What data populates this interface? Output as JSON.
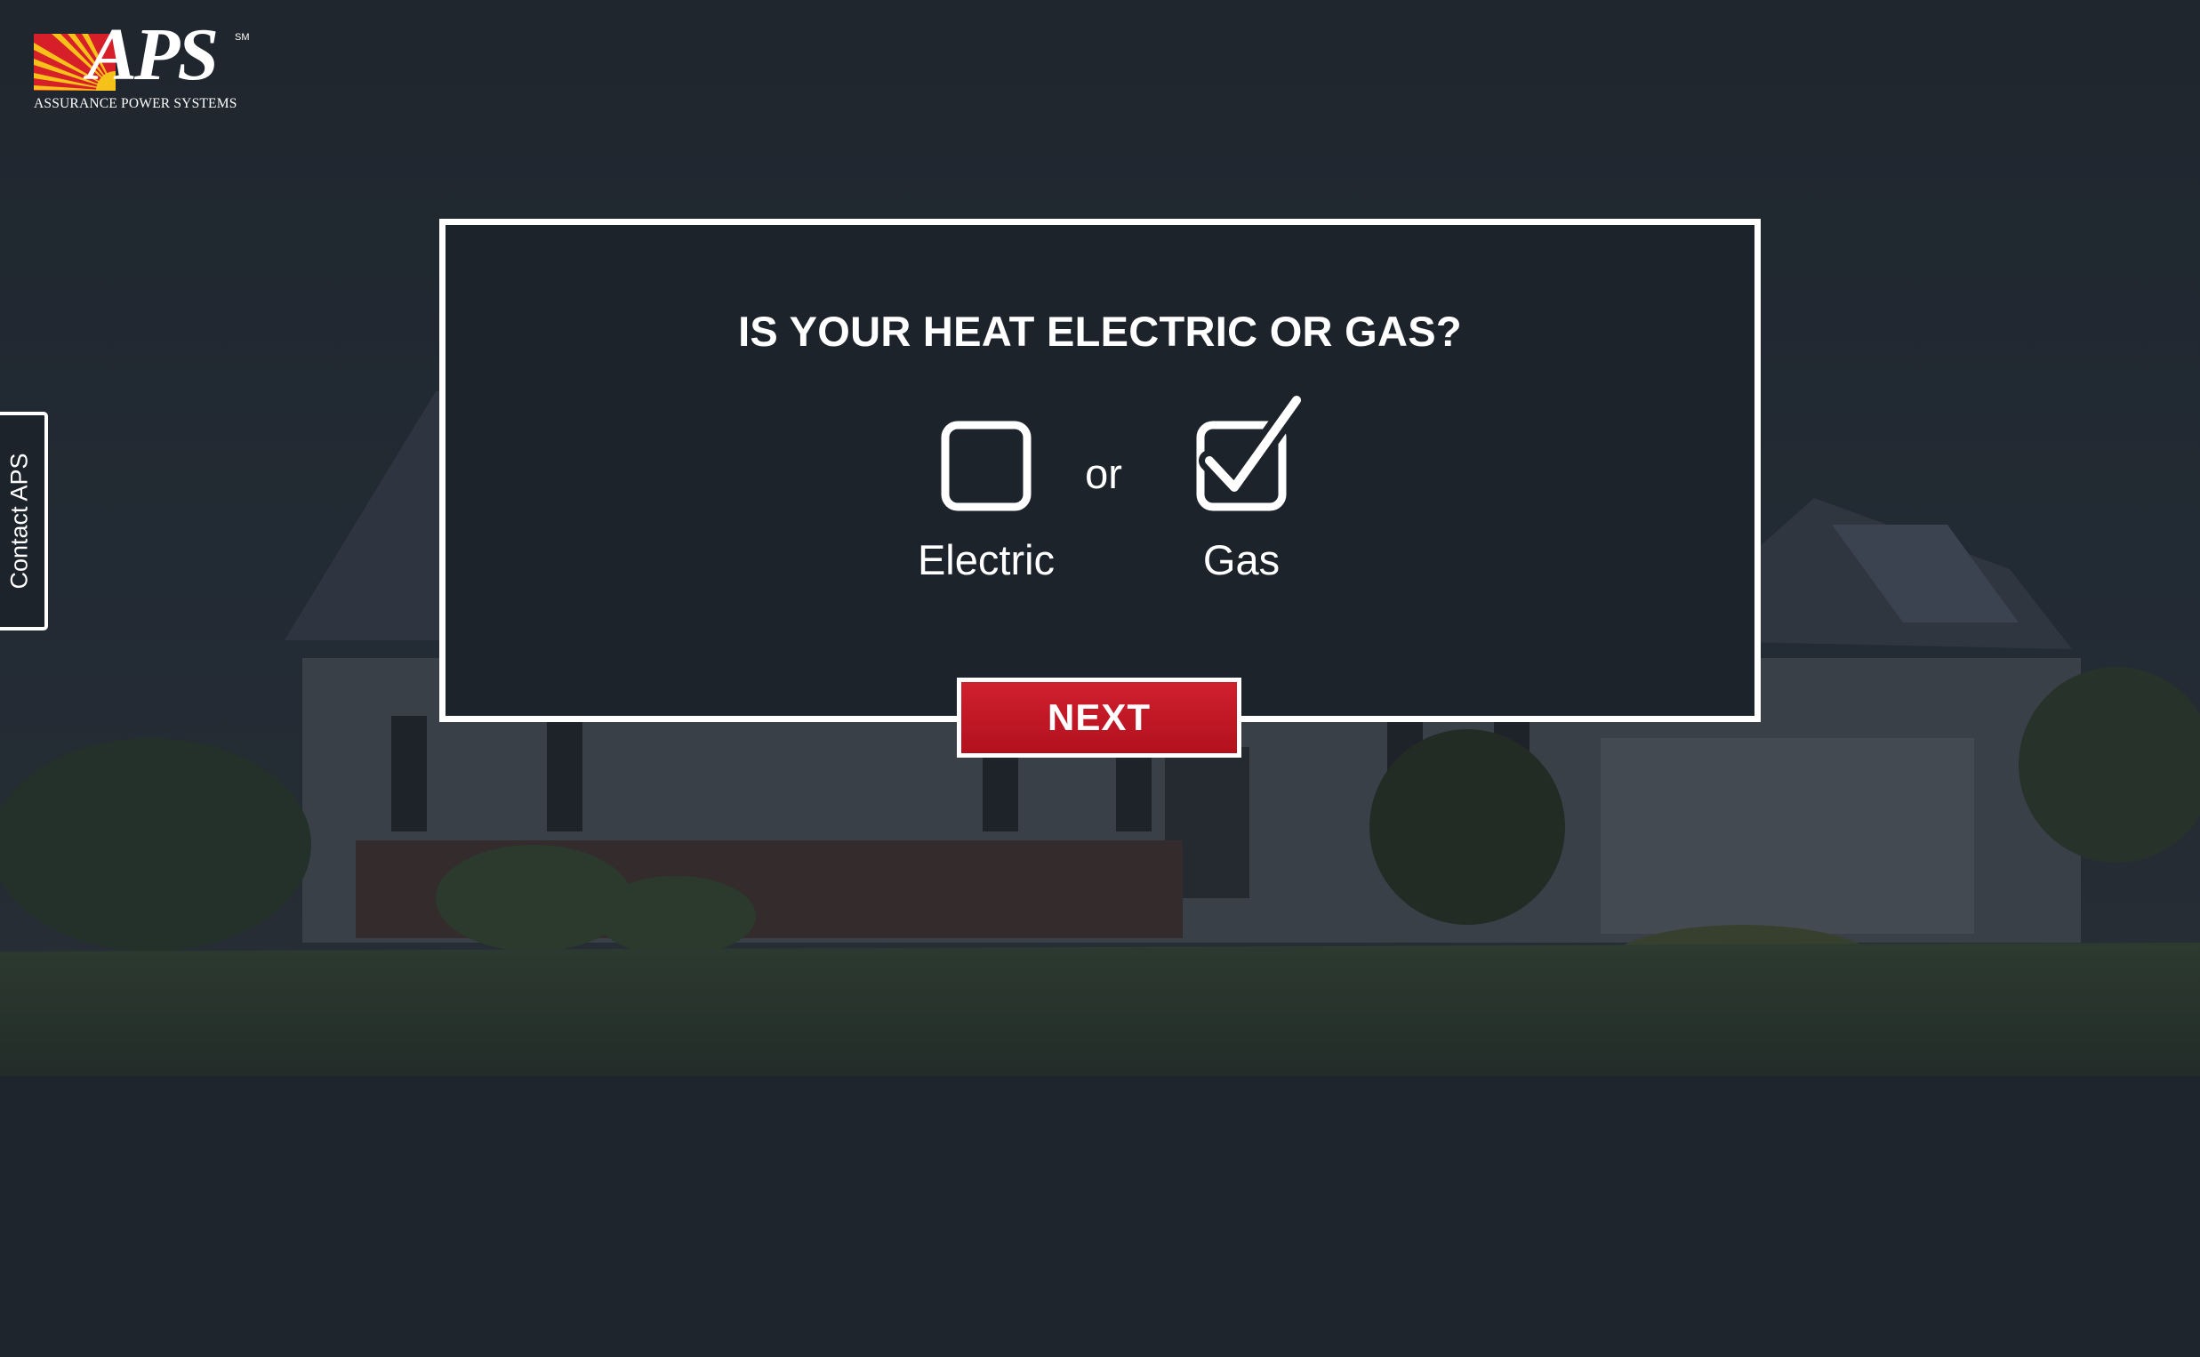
{
  "brand": {
    "name": "APS",
    "trademark": "SM",
    "tagline": "ASSURANCE POWER SYSTEMS",
    "logo_colors": {
      "red": "#d71f2a",
      "yellow": "#f6c21a"
    }
  },
  "contact_tab": {
    "label": "Contact APS"
  },
  "question": {
    "title": "IS YOUR HEAT ELECTRIC OR GAS?",
    "separator": "or",
    "options": [
      {
        "label": "Electric",
        "checked": false
      },
      {
        "label": "Gas",
        "checked": true
      }
    ]
  },
  "actions": {
    "next_label": "NEXT"
  },
  "colors": {
    "background": "#1d232b",
    "panel_border": "#ffffff",
    "button": "#c41826"
  }
}
